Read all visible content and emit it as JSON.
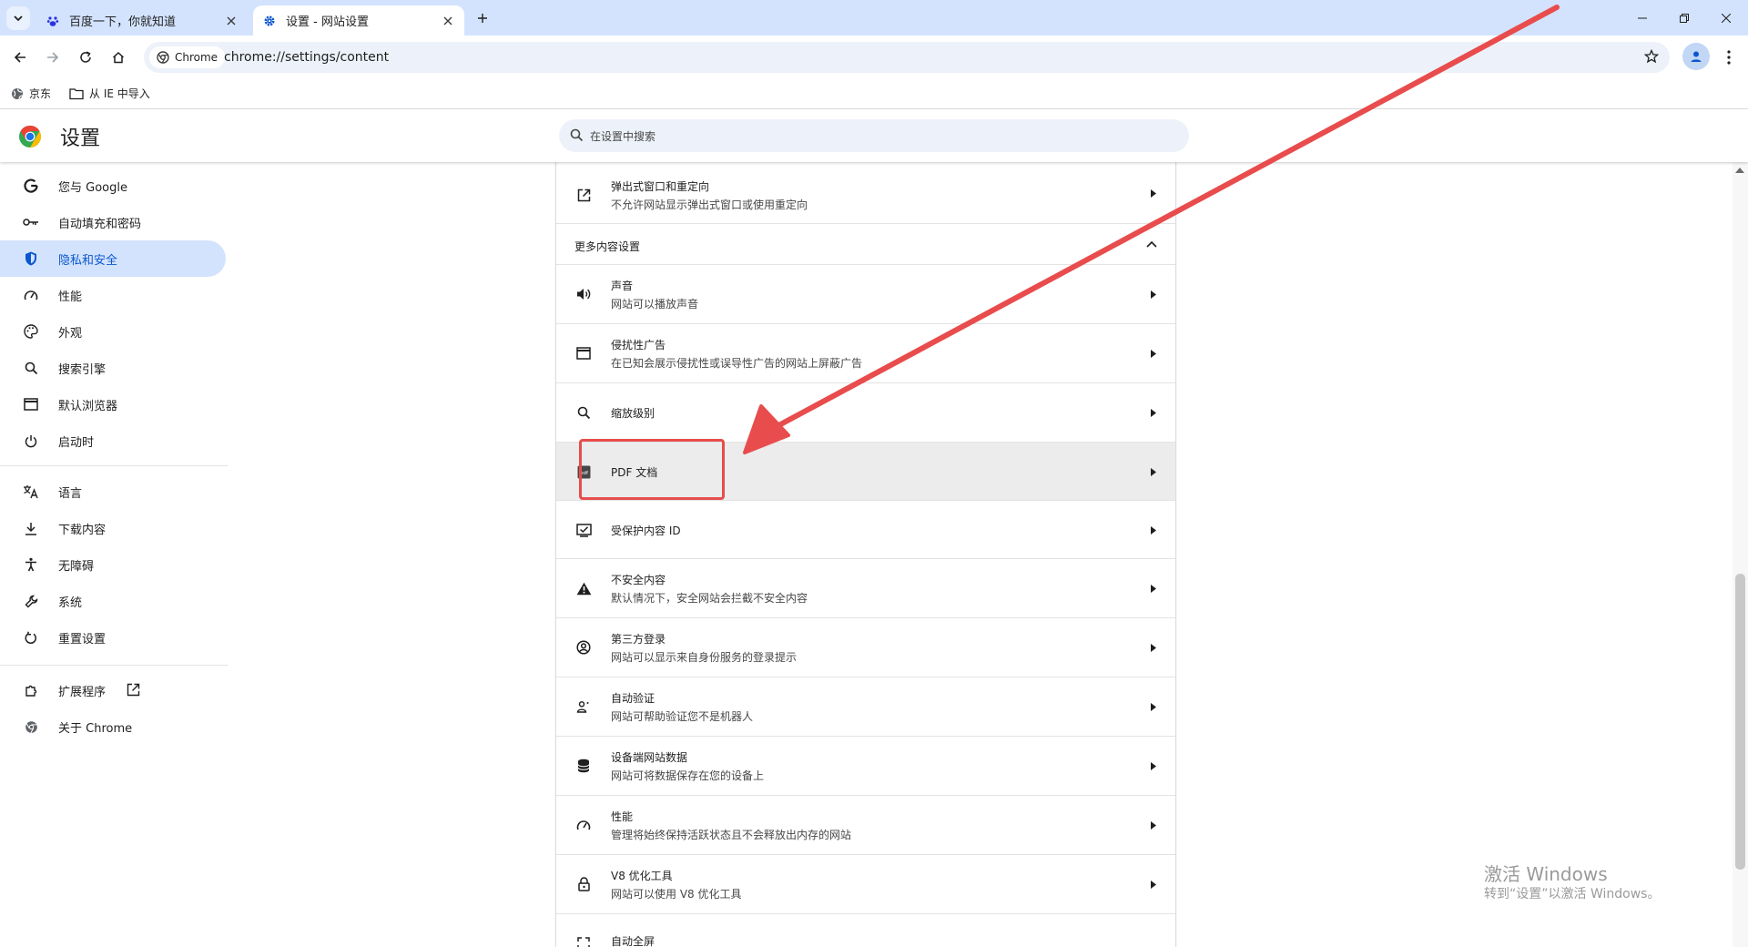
{
  "tabs": [
    {
      "title": "百度一下，你就知道",
      "favicon": "baidu-paw-icon"
    },
    {
      "title": "设置 - 网站设置",
      "favicon": "gear-icon"
    }
  ],
  "toolbar": {
    "chip_label": "Chrome",
    "url": "chrome://settings/content"
  },
  "bookmarks": [
    {
      "label": "京东",
      "icon": "globe-icon"
    },
    {
      "label": "从 IE 中导入",
      "icon": "folder-icon"
    }
  ],
  "header": {
    "title": "设置",
    "search_placeholder": "在设置中搜索"
  },
  "sidebar": {
    "items": [
      {
        "label": "您与 Google",
        "icon": "google-g-icon"
      },
      {
        "label": "自动填充和密码",
        "icon": "key-icon"
      },
      {
        "label": "隐私和安全",
        "icon": "shield-icon",
        "selected": true
      },
      {
        "label": "性能",
        "icon": "speedometer-icon"
      },
      {
        "label": "外观",
        "icon": "palette-icon"
      },
      {
        "label": "搜索引擎",
        "icon": "search-icon"
      },
      {
        "label": "默认浏览器",
        "icon": "browser-window-icon"
      },
      {
        "label": "启动时",
        "icon": "power-icon"
      },
      {
        "label": "语言",
        "icon": "translate-icon"
      },
      {
        "label": "下载内容",
        "icon": "download-icon"
      },
      {
        "label": "无障碍",
        "icon": "accessibility-icon"
      },
      {
        "label": "系统",
        "icon": "wrench-icon"
      },
      {
        "label": "重置设置",
        "icon": "reset-icon"
      },
      {
        "label": "扩展程序",
        "icon": "puzzle-icon"
      },
      {
        "label": "关于 Chrome",
        "icon": "chrome-icon"
      }
    ]
  },
  "content": {
    "top_row": {
      "title": "弹出式窗口和重定向",
      "subtitle": "不允许网站显示弹出式窗口或使用重定向",
      "icon": "open-in-new-icon"
    },
    "section_label": "更多内容设置",
    "rows": [
      {
        "title": "声音",
        "subtitle": "网站可以播放声音",
        "icon": "volume-icon"
      },
      {
        "title": "侵扰性广告",
        "subtitle": "在已知会展示侵扰性或误导性广告的网站上屏蔽广告",
        "icon": "ad-window-icon"
      },
      {
        "title": "缩放级别",
        "subtitle": "",
        "icon": "zoom-icon"
      },
      {
        "title": "PDF 文档",
        "subtitle": "",
        "icon": "pdf-icon",
        "highlighted": true
      },
      {
        "title": "受保护内容 ID",
        "subtitle": "",
        "icon": "protected-content-icon"
      },
      {
        "title": "不安全内容",
        "subtitle": "默认情况下，安全网站会拦截不安全内容",
        "icon": "warning-icon"
      },
      {
        "title": "第三方登录",
        "subtitle": "网站可以显示来自身份服务的登录提示",
        "icon": "account-circle-icon"
      },
      {
        "title": "自动验证",
        "subtitle": "网站可帮助验证您不是机器人",
        "icon": "person-check-icon"
      },
      {
        "title": "设备端网站数据",
        "subtitle": "网站可将数据保存在您的设备上",
        "icon": "database-icon"
      },
      {
        "title": "性能",
        "subtitle": "管理将始终保持活跃状态且不会释放出内存的网站",
        "icon": "speedometer-icon"
      },
      {
        "title": "V8 优化工具",
        "subtitle": "网站可以使用 V8 优化工具",
        "icon": "lock-icon"
      },
      {
        "title": "自动全屏",
        "subtitle": "",
        "icon": "fullscreen-icon"
      }
    ]
  },
  "watermark": {
    "line1": "激活 Windows",
    "line2": "转到“设置”以激活 Windows。"
  },
  "colors": {
    "tabstrip": "#d3e3fd",
    "accent": "#0b57d0",
    "selected_nav": "#d3e3fd",
    "annotation_red": "#e84c4c"
  }
}
